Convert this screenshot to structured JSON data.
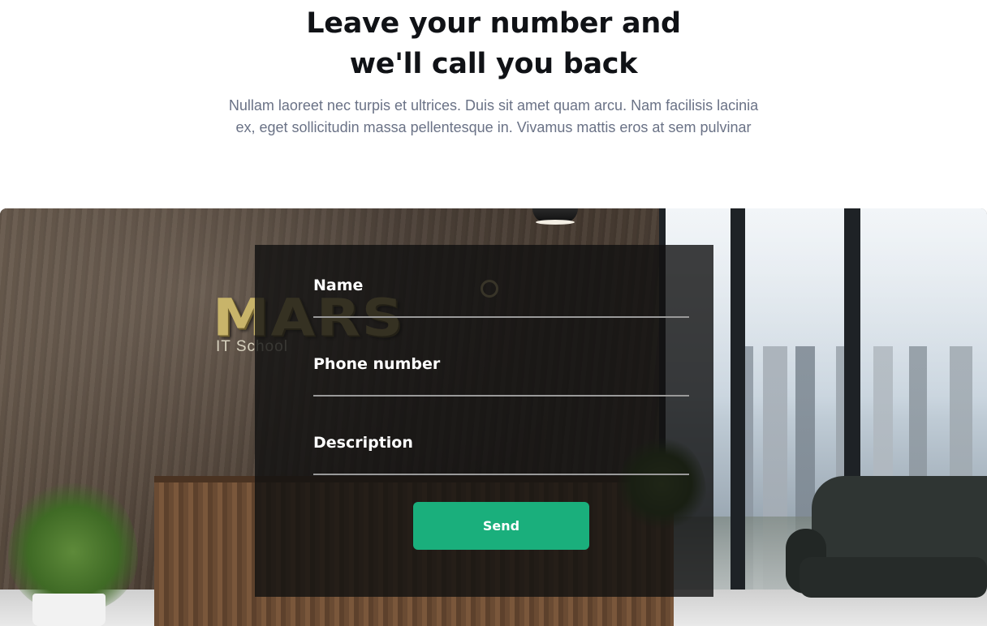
{
  "hero": {
    "title_line1": "Leave your number and",
    "title_line2": "we'll call you back",
    "subtitle": "Nullam laoreet nec turpis et ultrices. Duis sit amet quam arcu. Nam facilisis lacinia ex, eget sollicitudin massa pellentesque in. Vivamus mattis eros at sem pulvinar"
  },
  "background": {
    "logo_text": "MARS",
    "logo_subtext": "IT School"
  },
  "form": {
    "name_label": "Name",
    "name_value": "",
    "phone_label": "Phone number",
    "phone_value": "",
    "description_label": "Description",
    "description_value": "",
    "send_label": "Send"
  },
  "colors": {
    "accent": "#1aaf7c",
    "heading": "#101216",
    "subtitle": "#6a7286",
    "panel": "rgba(16,16,16,0.80)"
  }
}
